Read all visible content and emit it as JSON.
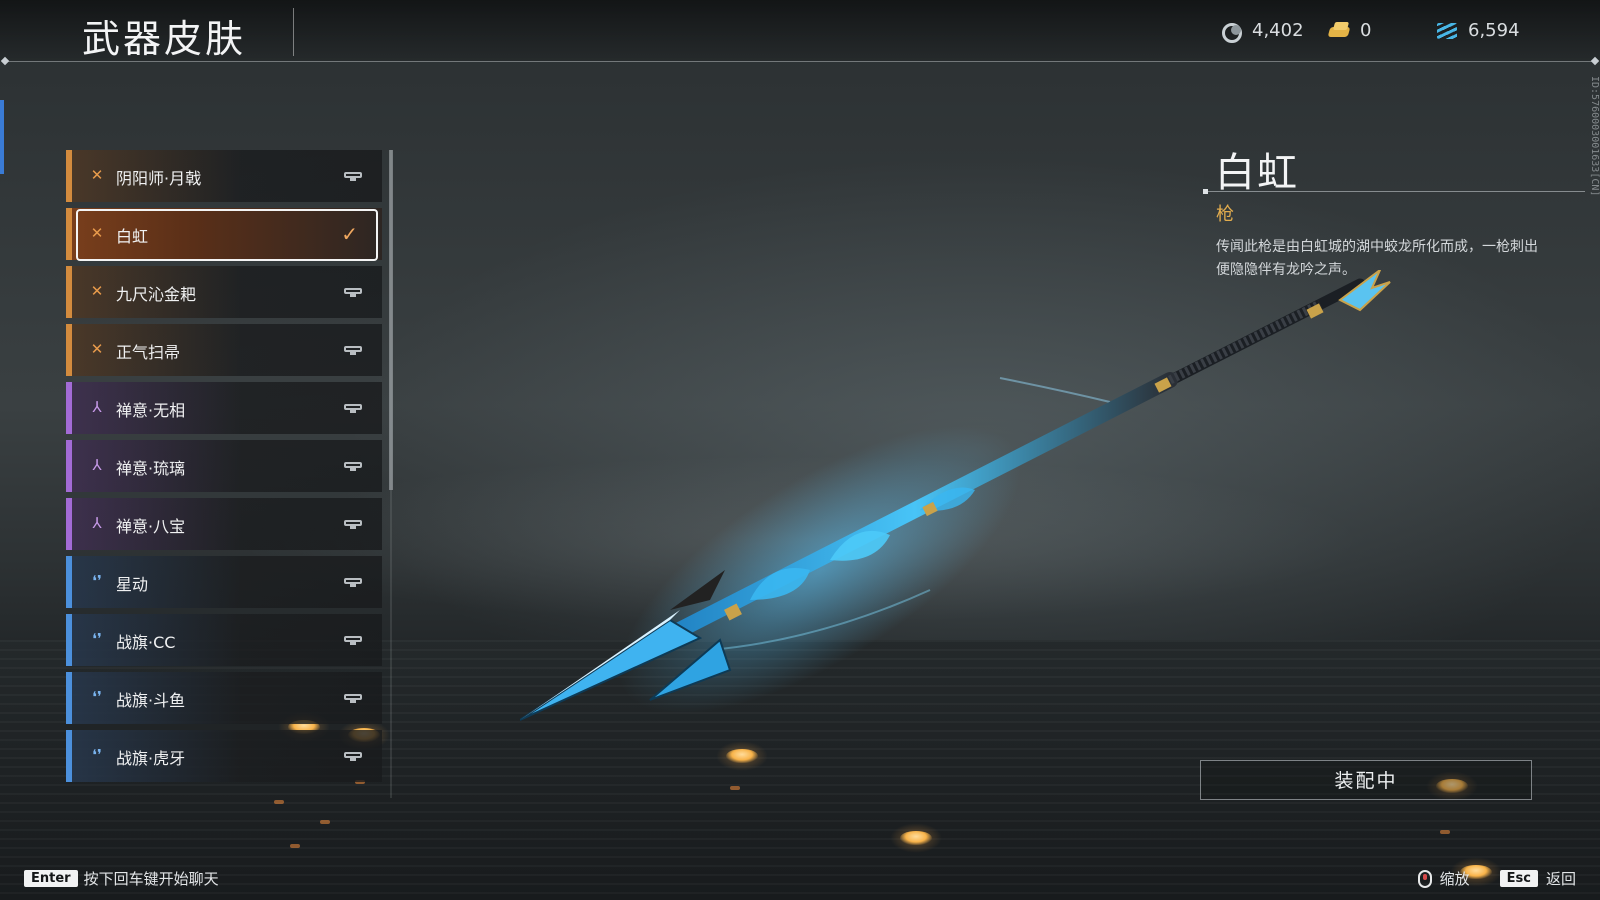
{
  "header": {
    "title": "武器皮肤",
    "currencies": [
      {
        "icon": "coin-icon",
        "value": "4,402"
      },
      {
        "icon": "gold-ingot-icon",
        "value": "0"
      },
      {
        "icon": "jade-feather-icon",
        "value": "6,594"
      }
    ],
    "side_id": "ID:5760003001633[CN]"
  },
  "skin_list": [
    {
      "name": "阴阳师·月戟",
      "rarity": "orange",
      "state": "locked"
    },
    {
      "name": "白虹",
      "rarity": "orange",
      "state": "selected"
    },
    {
      "name": "九尺沁金耙",
      "rarity": "orange",
      "state": "locked"
    },
    {
      "name": "正气扫帚",
      "rarity": "orange",
      "state": "locked"
    },
    {
      "name": "禅意·无相",
      "rarity": "purple",
      "state": "locked"
    },
    {
      "name": "禅意·琉璃",
      "rarity": "purple",
      "state": "locked"
    },
    {
      "name": "禅意·八宝",
      "rarity": "purple",
      "state": "locked"
    },
    {
      "name": "星动",
      "rarity": "blue",
      "state": "locked"
    },
    {
      "name": "战旗·CC",
      "rarity": "blue",
      "state": "locked"
    },
    {
      "name": "战旗·斗鱼",
      "rarity": "blue",
      "state": "locked"
    },
    {
      "name": "战旗·虎牙",
      "rarity": "blue",
      "state": "locked"
    }
  ],
  "detail": {
    "name": "白虹",
    "type": "枪",
    "description": "传闻此枪是由白虹城的湖中蛟龙所化而成，一枪刺出便隐隐伴有龙吟之声。"
  },
  "equip_button": "装配中",
  "footer": {
    "enter_key": "Enter",
    "enter_hint": "按下回车键开始聊天",
    "zoom_hint": "缩放",
    "esc_key": "Esc",
    "esc_hint": "返回"
  },
  "colors": {
    "orange_rarity": "#d38b3e",
    "purple_rarity": "#a36bd6",
    "blue_rarity": "#4c90dc",
    "accent_gold": "#e3ad4e",
    "spear_blue": "#3fb3f0"
  }
}
